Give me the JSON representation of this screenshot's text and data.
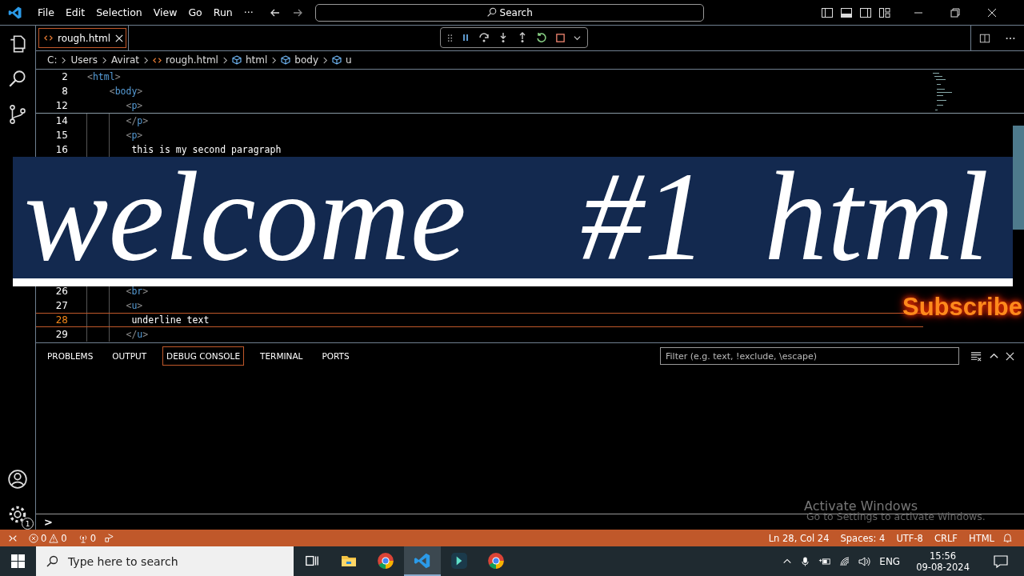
{
  "window": {
    "menu": [
      "File",
      "Edit",
      "Selection",
      "View",
      "Go",
      "Run",
      "···"
    ],
    "search": "Search"
  },
  "tabs": [
    {
      "label": "rough.html",
      "selected": true
    }
  ],
  "breadcrumbs": [
    {
      "kind": "folder",
      "label": "C:"
    },
    {
      "kind": "folder",
      "label": "Users"
    },
    {
      "kind": "folder",
      "label": "Avirat"
    },
    {
      "kind": "file",
      "label": "rough.html"
    },
    {
      "kind": "element",
      "label": "html"
    },
    {
      "kind": "element",
      "label": "body"
    },
    {
      "kind": "element",
      "label": "u"
    }
  ],
  "editor": {
    "sticky": [
      {
        "number": "2",
        "code": "<html>",
        "current": false
      },
      {
        "number": "8",
        "code": "    <body>",
        "current": false
      },
      {
        "number": "12",
        "code": "       <p>",
        "current": false
      }
    ],
    "lines_above": [
      {
        "number": "14",
        "code": "       </p>",
        "current": false
      },
      {
        "number": "15",
        "code": "       <p>",
        "current": false
      },
      {
        "number": "16",
        "code": "        this is my second paragraph",
        "current": false
      }
    ],
    "lines_below": [
      {
        "number": "26",
        "code": "       <br>",
        "current": false
      },
      {
        "number": "27",
        "code": "       <u>",
        "current": false
      },
      {
        "number": "28",
        "code": "        underline text",
        "current": true
      },
      {
        "number": "29",
        "code": "       </u>",
        "current": false
      }
    ]
  },
  "panel": {
    "tabs": [
      {
        "label": "PROBLEMS",
        "selected": false
      },
      {
        "label": "OUTPUT",
        "selected": false
      },
      {
        "label": "DEBUG CONSOLE",
        "selected": true
      },
      {
        "label": "TERMINAL",
        "selected": false
      },
      {
        "label": "PORTS",
        "selected": false
      }
    ],
    "filter_placeholder": "Filter (e.g. text, !exclude, \\escape)",
    "prompt": ">"
  },
  "settings_badge": "1",
  "status_bar": {
    "errors": "0",
    "warnings": "0",
    "ports": "0",
    "right": [
      "Ln 28, Col 24",
      "Spaces: 4",
      "UTF-8",
      "CRLF",
      "HTML"
    ]
  },
  "overlay": {
    "banner": "welcome  #1 html",
    "subscribe": "Subscribe"
  },
  "watermark": {
    "title": "Activate Windows",
    "subtitle": "Go to Settings to activate Windows."
  },
  "taskbar": {
    "search_placeholder": "Type here to search",
    "apps": [
      {
        "kind": "taskview",
        "selected": false
      },
      {
        "kind": "folder",
        "selected": false
      },
      {
        "kind": "browser",
        "selected": false
      },
      {
        "kind": "editor",
        "selected": true
      },
      {
        "kind": "video",
        "selected": false
      },
      {
        "kind": "browser",
        "selected": false
      }
    ],
    "language": "ENG",
    "time": "15:56",
    "date": "09-08-2024"
  }
}
